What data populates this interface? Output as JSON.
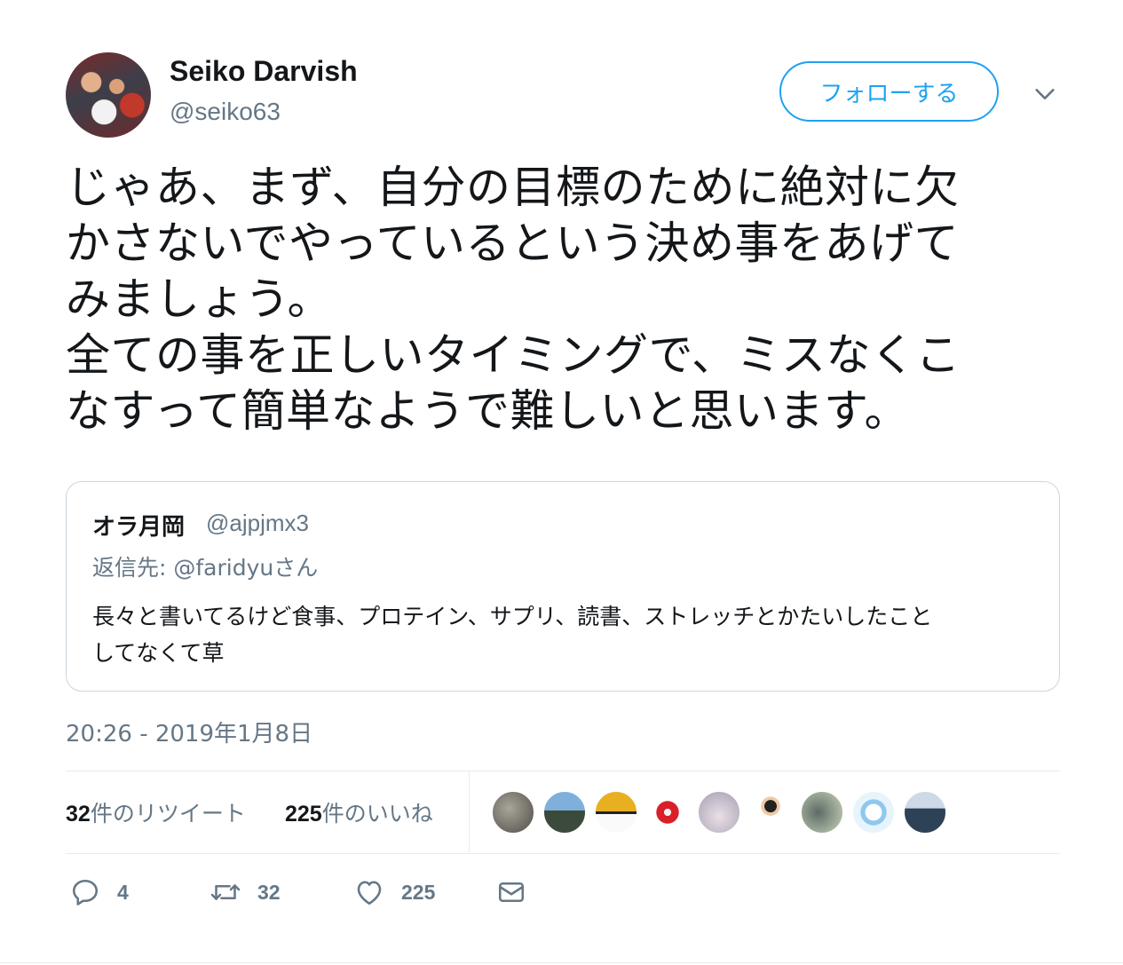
{
  "author": {
    "name": "Seiko Darvish",
    "handle": "@seiko63"
  },
  "follow_button_label": "フォローする",
  "tweet_text": "じゃあ、まず、自分の目標のために絶対に欠\nかさないでやっているという決め事をあげて\nみましょう。\n全ての事を正しいタイミングで、ミスなくこ\nなすって簡単なようで難しいと思います。",
  "quoted_tweet": {
    "name": "オラ月岡",
    "handle": "@ajpjmx3",
    "reply_to": "返信先: @faridyuさん",
    "text": "長々と書いてるけど食事、プロテイン、サプリ、読書、ストレッチとかたいしたこと\nしてなくて草"
  },
  "timestamp": "20:26 - 2019年1月8日",
  "stats": {
    "retweet_count": "32",
    "retweet_label": "件のリツイート",
    "like_count": "225",
    "like_label": "件のいいね"
  },
  "likers": [
    {
      "icon": "cat-avatar",
      "color": "#6b6a64"
    },
    {
      "icon": "person-field-avatar",
      "color": "#4a6b8c"
    },
    {
      "icon": "pokeball-avatar",
      "color": "#d4a017"
    },
    {
      "icon": "lips-avatar",
      "color": "#e23b3b"
    },
    {
      "icon": "cherry-blossom-avatar",
      "color": "#cfc6d8"
    },
    {
      "icon": "person-suit-avatar",
      "color": "#f4f4f4"
    },
    {
      "icon": "grey-cat-avatar",
      "color": "#7c8a80"
    },
    {
      "icon": "ring-avatar",
      "color": "#8fc8ef"
    },
    {
      "icon": "silhouette-sky-avatar",
      "color": "#3f5a73"
    }
  ],
  "actions": {
    "reply_count": "4",
    "retweet_count": "32",
    "like_count": "225"
  }
}
